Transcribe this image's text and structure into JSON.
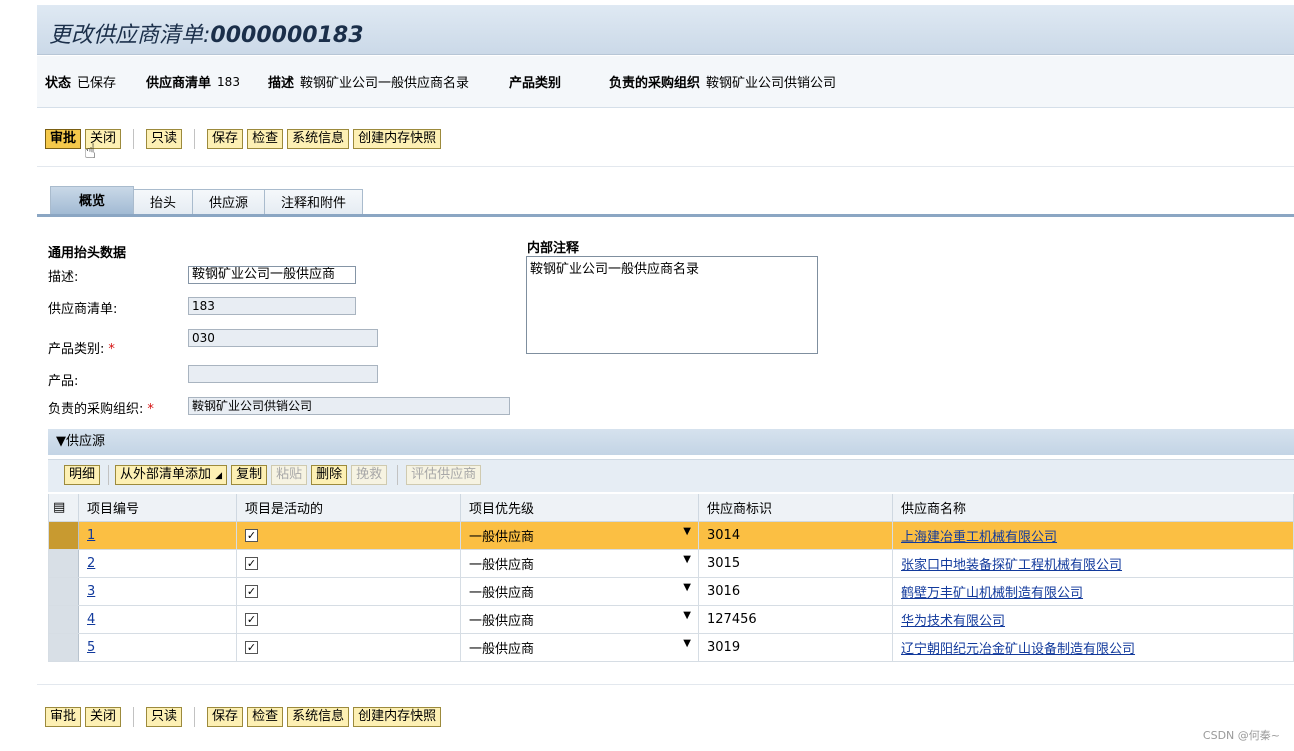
{
  "title": {
    "prefix": "更改供应商清单:",
    "id": "0000000183"
  },
  "status": {
    "state_label": "状态",
    "state_value": "已保存",
    "list_label": "供应商清单",
    "list_value": "183",
    "desc_label": "描述",
    "desc_value": "鞍钢矿业公司一般供应商名录",
    "category_label": "产品类别",
    "org_label": "负责的采购组织",
    "org_value": "鞍钢矿业公司供销公司"
  },
  "toolbar": {
    "approve": "审批",
    "close": "关闭",
    "readonly": "只读",
    "save": "保存",
    "check": "检查",
    "sysinfo": "系统信息",
    "snapshot": "创建内存快照"
  },
  "tabs": [
    "概览",
    "抬头",
    "供应源",
    "注释和附件"
  ],
  "general": {
    "heading": "通用抬头数据",
    "desc_label": "描述:",
    "desc_value": "鞍钢矿业公司一般供应商",
    "list_label": "供应商清单:",
    "list_value": "183",
    "category_label": "产品类别:",
    "category_value": "030",
    "product_label": "产品:",
    "product_value": "",
    "org_label": "负责的采购组织:",
    "org_value": "鞍钢矿业公司供销公司",
    "required_mark": "*"
  },
  "internal_note": {
    "heading": "内部注释",
    "text": "鞍钢矿业公司一般供应商名录"
  },
  "sources": {
    "section_title": "▼供应源",
    "buttons": {
      "detail": "明细",
      "add_external": "从外部清单添加",
      "copy": "复制",
      "paste": "粘贴",
      "delete": "删除",
      "undo": "挽救",
      "evaluate": "评估供应商"
    },
    "columns": [
      "项目编号",
      "项目是活动的",
      "项目优先级",
      "供应商标识",
      "供应商名称"
    ],
    "rows": [
      {
        "no": "1",
        "active": "✓",
        "priority": "一般供应商",
        "vendor_id": "3014",
        "vendor_name": "上海建冶重工机械有限公司"
      },
      {
        "no": "2",
        "active": "✓",
        "priority": "一般供应商",
        "vendor_id": "3015",
        "vendor_name": "张家口中地装备探矿工程机械有限公司"
      },
      {
        "no": "3",
        "active": "✓",
        "priority": "一般供应商",
        "vendor_id": "3016",
        "vendor_name": "鹤壁万丰矿山机械制造有限公司"
      },
      {
        "no": "4",
        "active": "✓",
        "priority": "一般供应商",
        "vendor_id": "127456",
        "vendor_name": "华为技术有限公司"
      },
      {
        "no": "5",
        "active": "✓",
        "priority": "一般供应商",
        "vendor_id": "3019",
        "vendor_name": "辽宁朝阳纪元冶金矿山设备制造有限公司"
      }
    ]
  },
  "watermark": "CSDN @何秦~",
  "colors": {
    "selected_row": "#fbbf43",
    "button_bg": "#fdf0b4",
    "header_bg": "#cbd9e8"
  }
}
